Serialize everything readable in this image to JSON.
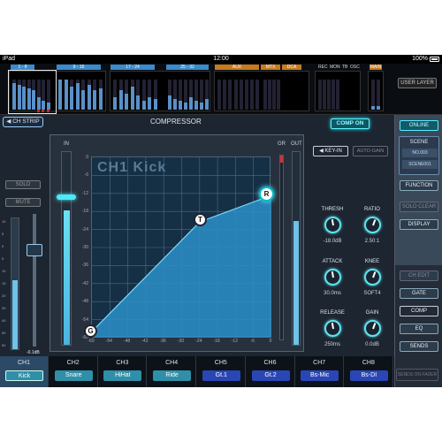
{
  "status_bar": {
    "device": "iPad",
    "time": "12:00",
    "battery": "100%"
  },
  "overview": {
    "groups": [
      {
        "label": "1 - 8",
        "color": "#3a8acc"
      },
      {
        "label": "9 - 16",
        "color": "#3a8acc"
      },
      {
        "label": "17 - 24",
        "color": "#3a8acc"
      },
      {
        "label": "25 - 32",
        "color": "#3a8acc"
      },
      {
        "label": "AUX",
        "color": "#c77a1e"
      },
      {
        "label": "MTX",
        "color": "#c77a1e"
      },
      {
        "label": "DCA",
        "color": "#c77a1e"
      }
    ],
    "small_labels": [
      "REC",
      "MON",
      "TB",
      "OSC"
    ],
    "main_label": "MAIN",
    "main_color": "#c77a1e",
    "user_layer": "USER LAYER"
  },
  "header": {
    "ch_strip": "CH STRIP",
    "title": "COMPRESSOR",
    "comp_on": "COMP ON"
  },
  "left_strip": {
    "solo": "SOLO",
    "mute": "MUTE",
    "fader_value": "-0.1dB",
    "scale": [
      "10",
      "5",
      "0",
      "5",
      "10",
      "15",
      "20",
      "30",
      "40",
      "50",
      "60"
    ]
  },
  "graph": {
    "title": "CH1  Kick",
    "in_label": "IN",
    "gr_label": "GR",
    "out_label": "OUT",
    "y_ticks": [
      "0",
      "-6",
      "-12",
      "-18",
      "-24",
      "-30",
      "-36",
      "-42",
      "-48",
      "-54",
      "-60"
    ],
    "x_ticks": [
      "-60",
      "-54",
      "-48",
      "-42",
      "-36",
      "-30",
      "-24",
      "-18",
      "-12",
      "-6",
      "0"
    ],
    "points": {
      "g": "G",
      "t": "T",
      "r": "R"
    }
  },
  "knobs": {
    "key_in": "KEY-IN",
    "auto_gain": "AUTO-GAIN",
    "items": [
      {
        "label": "THRESH",
        "value": "-18.0dB"
      },
      {
        "label": "RATIO",
        "value": "2.50:1"
      },
      {
        "label": "ATTACK",
        "value": "30.0ms"
      },
      {
        "label": "KNEE",
        "value": "SOFT4"
      },
      {
        "label": "RELEASE",
        "value": "250ms"
      },
      {
        "label": "GAIN",
        "value": "0.0dB"
      }
    ]
  },
  "right_panel": {
    "online": "ONLINE",
    "scene_title": "SCENE",
    "scene_no": "NO.003",
    "scene_name": "SCENE001",
    "function": "FUNCTION",
    "solo_clear": "SOLO CLEAR",
    "display": "DISPLAY",
    "ch_edit": "CH EDIT",
    "gate": "GATE",
    "comp": "COMP",
    "eq": "EQ",
    "sends": "SENDS",
    "sends_on_fader": "SENDS ON FADER"
  },
  "channels": [
    {
      "num": "CH1",
      "name": "Kick",
      "color": "#2f8fa8"
    },
    {
      "num": "CH2",
      "name": "Snare",
      "color": "#2f8fa8"
    },
    {
      "num": "CH3",
      "name": "HiHat",
      "color": "#2f8fa8"
    },
    {
      "num": "CH4",
      "name": "Ride",
      "color": "#2f8fa8"
    },
    {
      "num": "CH5",
      "name": "Gt.1",
      "color": "#2a46b4"
    },
    {
      "num": "CH6",
      "name": "Gt.2",
      "color": "#2a46b4"
    },
    {
      "num": "CH7",
      "name": "Bs-Mic",
      "color": "#2a46b4"
    },
    {
      "num": "CH8",
      "name": "Bs-DI",
      "color": "#2a46b4"
    }
  ]
}
